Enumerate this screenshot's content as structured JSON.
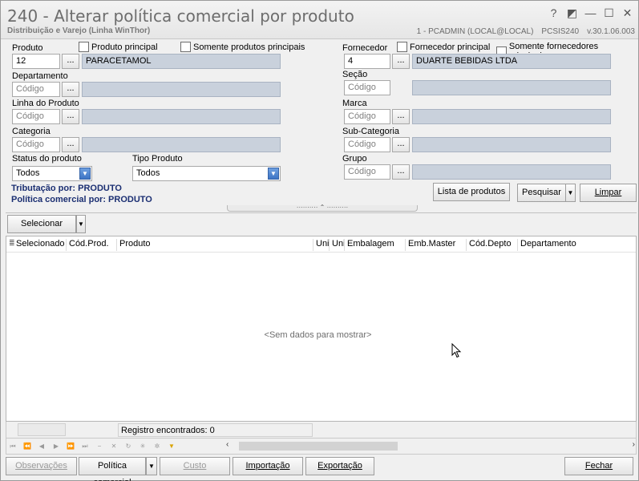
{
  "window": {
    "title": "240 - Alterar política comercial por produto",
    "subtitle": "Distribuição e Varejo (Linha WinThor)",
    "controls": [
      "?",
      "◩",
      "—",
      "☐",
      "✕"
    ],
    "session": "1 - PCADMIN (LOCAL@LOCAL)",
    "routine": "PCSIS240",
    "version": "v.30.1.06.003"
  },
  "filters": {
    "produto": {
      "label": "Produto",
      "code": "12",
      "desc": "PARACETAMOL",
      "chk1": "Produto principal",
      "chk2": "Somente produtos principais"
    },
    "departamento": {
      "label": "Departamento",
      "placeholder": "Código"
    },
    "linha": {
      "label": "Linha do Produto",
      "placeholder": "Código"
    },
    "categoria": {
      "label": "Categoria",
      "placeholder": "Código"
    },
    "status": {
      "label": "Status do produto",
      "value": "Todos"
    },
    "tipo": {
      "label": "Tipo Produto",
      "value": "Todos"
    },
    "fornecedor": {
      "label": "Fornecedor",
      "code": "4",
      "desc": "DUARTE BEBIDAS LTDA",
      "chk1": "Fornecedor principal",
      "chk2": "Somente fornecedores principais"
    },
    "secao": {
      "label": "Seção",
      "placeholder": "Código"
    },
    "marca": {
      "label": "Marca",
      "placeholder": "Código"
    },
    "subcategoria": {
      "label": "Sub-Categoria",
      "placeholder": "Código"
    },
    "grupo": {
      "label": "Grupo",
      "placeholder": "Código"
    },
    "ellipsis": "..."
  },
  "info": {
    "tributacao": "Tributação por: PRODUTO",
    "politica": "Política comercial por: PRODUTO"
  },
  "actions": {
    "lista": "Lista de produtos",
    "pesquisar": "Pesquisar",
    "limpar": "Limpar",
    "selecionar": "Selecionar"
  },
  "grid": {
    "columns": [
      "Selecionado",
      "Cód.Prod.",
      "Produto",
      "Uni",
      "Uni",
      "Embalagem",
      "Emb.Master",
      "Cód.Depto",
      "Departamento"
    ],
    "empty": "<Sem dados para mostrar>",
    "footer": "Registro encontrados: 0"
  },
  "bottom": {
    "observacoes": "Observações",
    "politica": "Política comercial",
    "custo": "Custo",
    "importacao": "Importação",
    "exportacao": "Exportação",
    "fechar": "Fechar"
  },
  "colors": {
    "accent": "#1b2f72",
    "readonly": "#c9d1dc",
    "combo_arrow": "#3d74c5"
  }
}
